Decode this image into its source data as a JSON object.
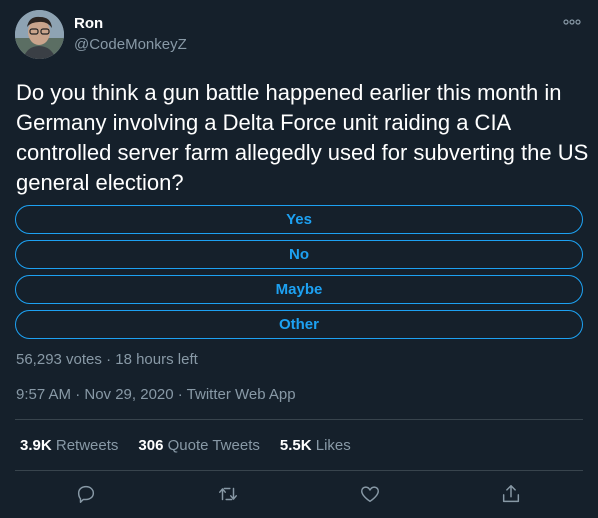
{
  "author": {
    "name": "Ron",
    "handle": "@CodeMonkeyZ",
    "avatar_icon": "avatar-photo"
  },
  "tweet": {
    "text": "Do you think a gun battle happened earlier this month in Germany involving a Delta Force unit raiding a CIA controlled server farm allegedly used for subverting the US general election?"
  },
  "poll": {
    "options": [
      "Yes",
      "No",
      "Maybe",
      "Other"
    ],
    "meta": "56,293 votes · 18 hours left"
  },
  "timestamp": {
    "time": "9:57 AM · Nov 29, 2020 · ",
    "source": "Twitter Web App"
  },
  "stats": {
    "retweets_count": "3.9K",
    "retweets_label": "Retweets",
    "quotes_count": "306",
    "quotes_label": "Quote Tweets",
    "likes_count": "5.5K",
    "likes_label": "Likes"
  },
  "colors": {
    "background": "#15202b",
    "accent": "#1da1f2",
    "muted": "#8899a6",
    "divider": "#38444d"
  },
  "icons": [
    "reply-icon",
    "retweet-icon",
    "like-icon",
    "share-icon",
    "more-icon"
  ]
}
